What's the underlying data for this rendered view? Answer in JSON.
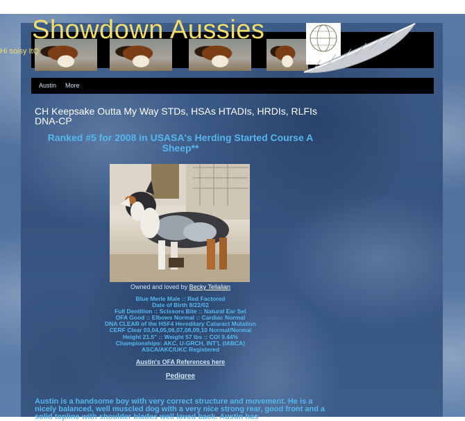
{
  "site": {
    "title": "Showdown Aussies",
    "overlap_text": "Hi soisy ItQ"
  },
  "nav": {
    "items": [
      {
        "label": "Austin"
      },
      {
        "label": "More"
      }
    ]
  },
  "page": {
    "headline": "CH Keepsake Outta My Way STDs, HSAs HTADIs, HRDIs, RLFIs DNA-CP",
    "ranked": "Ranked #5 for 2008 in USASA's Herding Started Course A Sheep**",
    "caption_prefix": "Owned and loved by",
    "owner_link": "Becky Tellalian",
    "specs": [
      "Blue Merle Male :: Red Factored",
      "Date of Birth   8/22/02",
      "Full Dentition ::  Scissors Bite :: Natural Ear Set",
      "OFA Good :: Elbows Normal :: Cardiac Normal",
      "DNA CLEAR of the HSF4 Hereditary Cataract Mutation",
      "CERF Clear 03,04,05,06,07,08,09,10  Normal/Normal",
      "Height 21.5\" :: Weight 57 lbs :: COI 9.44%",
      "Championships: AKC, U-GRCH, INT'L (IABCA)",
      "ASCA/AKC/UKC Registered"
    ],
    "ofa_link": "Austin's OFA References here",
    "pedigree_link": "Pedigree",
    "bio": "Austin is a handsome boy with very correct structure and movement.  He is a nicely balanced, well muscled dog with a very nice strong rear, good front and a solid topline with shoulder blades well laved back.  Austin has"
  },
  "colors": {
    "title": "#f2dd6a",
    "accent_blue": "#57b6ee",
    "nav_bg": "#000000"
  }
}
